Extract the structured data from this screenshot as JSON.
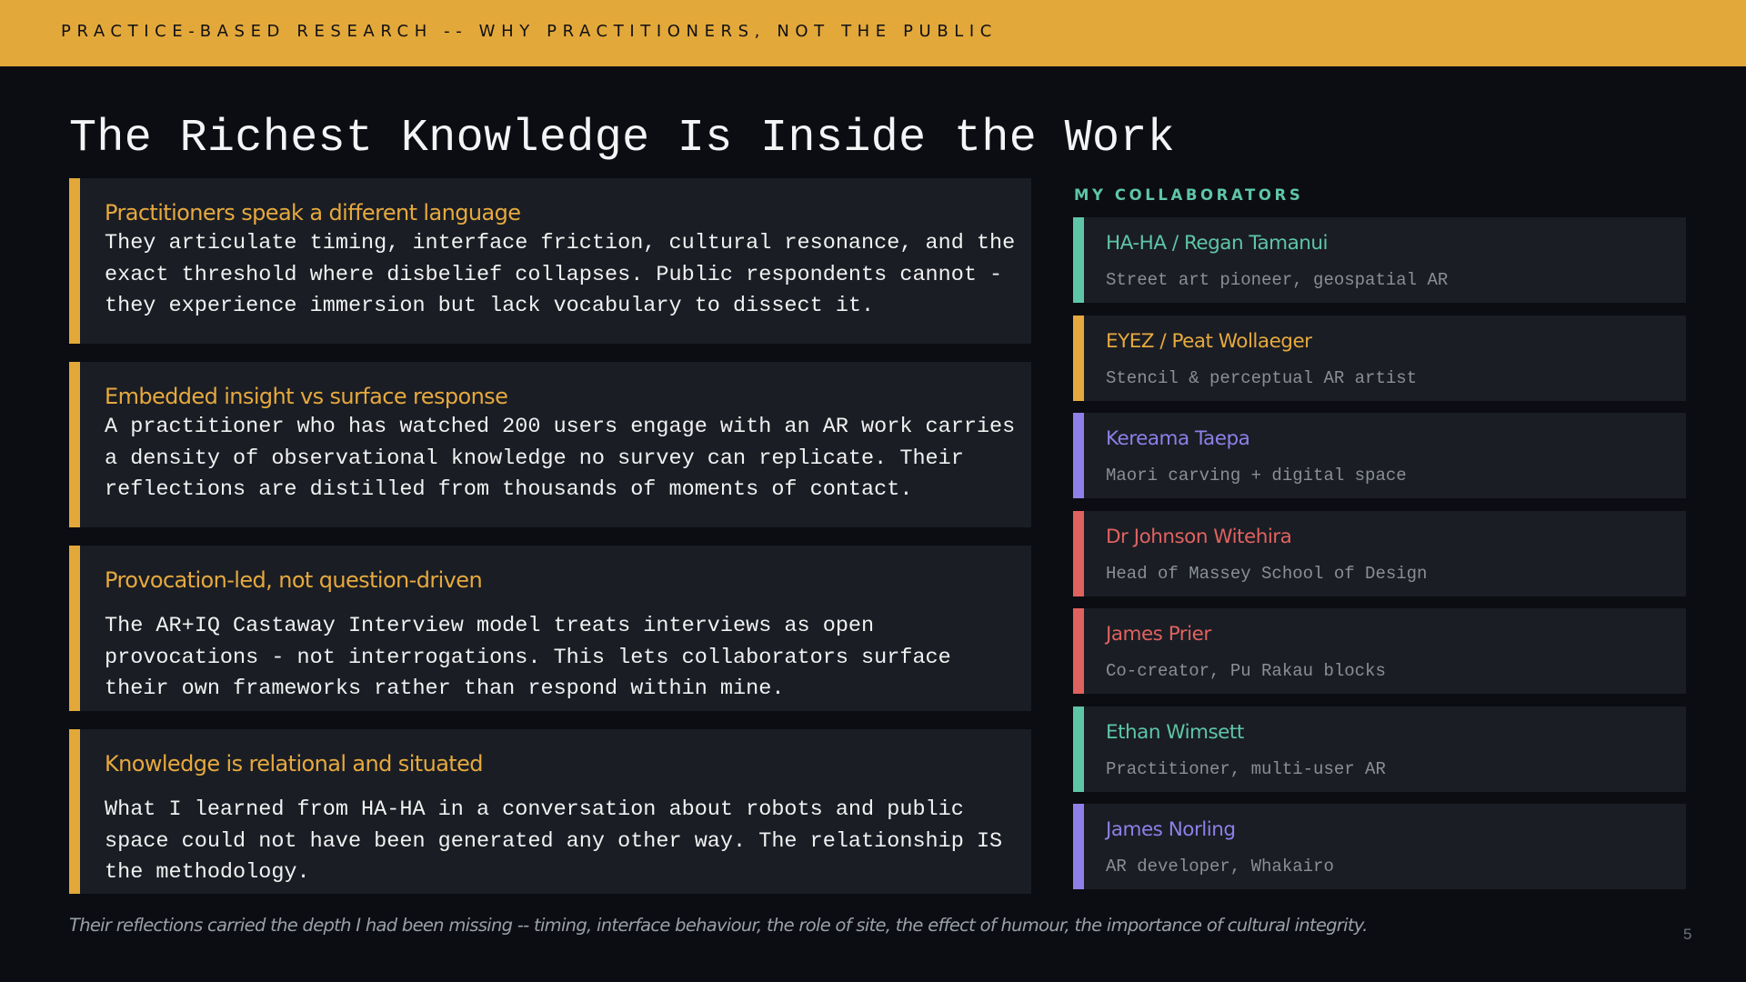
{
  "header": {
    "kicker": "PRACTICE-BASED RESEARCH -- WHY PRACTITIONERS, NOT THE PUBLIC"
  },
  "title": "The Richest Knowledge Is Inside the Work",
  "cards": [
    {
      "heading": "Practitioners speak a different language",
      "body": "They articulate timing, interface friction, cultural resonance, and the exact threshold where disbelief collapses. Public respondents cannot - they experience immersion but lack vocabulary to dissect it."
    },
    {
      "heading": "Embedded insight vs surface response",
      "body": "A practitioner who has watched 200 users engage with an AR work carries a density of observational knowledge no survey can replicate. Their reflections are distilled from thousands of moments of contact."
    },
    {
      "heading": "Provocation-led, not question-driven",
      "body": "The AR+IQ Castaway Interview model treats interviews as open provocations - not interrogations. This lets collaborators surface their own frameworks rather than respond within mine."
    },
    {
      "heading": "Knowledge is relational and situated",
      "body": "What I learned from HA-HA in a conversation about robots and public space could not have been generated any other way. The relationship IS the methodology."
    }
  ],
  "collaborators": {
    "heading": "MY COLLABORATORS",
    "items": [
      {
        "name": "HA-HA / Regan Tamanui",
        "role": "Street art pioneer, geospatial AR",
        "color": "#5ec6a6"
      },
      {
        "name": "EYEZ / Peat Wollaeger",
        "role": "Stencil & perceptual AR artist",
        "color": "#e6a93e"
      },
      {
        "name": "Kereama Taepa",
        "role": "Maori carving + digital space",
        "color": "#8f7fe8"
      },
      {
        "name": "Dr Johnson Witehira",
        "role": "Head of Massey School of Design",
        "color": "#e0625f"
      },
      {
        "name": "James Prier",
        "role": "Co-creator, Pu Rakau blocks",
        "color": "#e0625f"
      },
      {
        "name": "Ethan Wimsett",
        "role": "Practitioner, multi-user AR",
        "color": "#5ec6a6"
      },
      {
        "name": "James Norling",
        "role": "AR developer, Whakairo",
        "color": "#8f7fe8"
      }
    ]
  },
  "footer": {
    "quote": "Their reflections carried the depth I had been missing -- timing, interface behaviour, the role of site, the effect of humour, the importance of cultural integrity.",
    "page_number": "5"
  }
}
